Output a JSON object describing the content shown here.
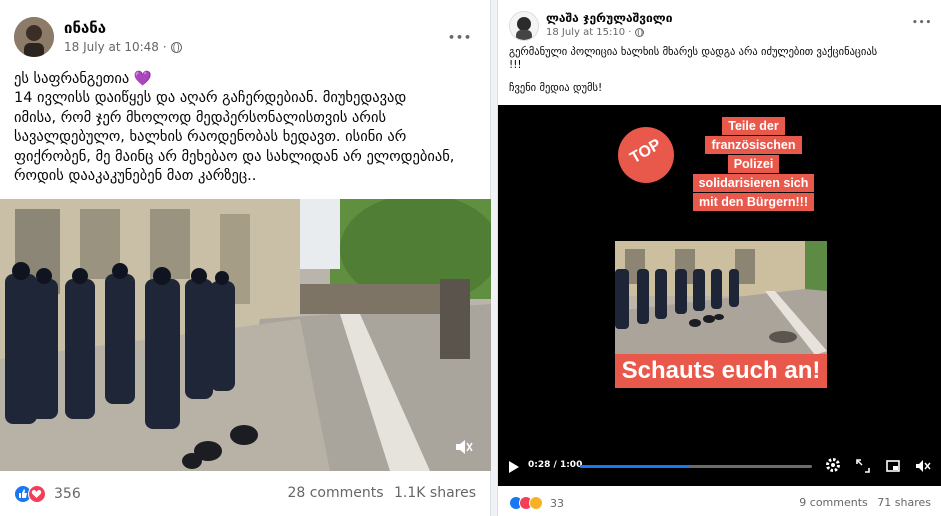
{
  "left_post": {
    "author": "ინანა",
    "date": "18 July at 10:48 ·",
    "more": "•••",
    "caption_lines": [
      "ეს საფრანგეთია 💜",
      "14 ივლისს დაიწყეს და აღარ გაჩერდებიან. მიუხედავად",
      "იმისა, რომ ჯერ მხოლოდ მედპერსონალისთვის არის",
      "სავალდებულო, ხალხის რაოდენობას ხედავთ. ისინი არ",
      "ფიქრობენ, მე მაინც არ მეხებაო და სახლიდან არ ელოდებიან,",
      "როდის დააკაკუნებენ მათ კარზეც.."
    ],
    "reaction_count": "356",
    "comments": "28 comments",
    "shares": "1.1K shares"
  },
  "right_post": {
    "author": "ლაშა ჯერულაშვილი",
    "date": "18 July at 15:10 ·",
    "more": "•••",
    "caption_lines": [
      "გერმანული პოლიცია ხალხის მხარეს დადგა არა იძულებით ვაქცინაციას",
      "!!!",
      "ჩვენი მედია დუმს!"
    ],
    "video": {
      "badge": "TOP",
      "title_lines": [
        "Teile der",
        "französischen",
        "Polizei",
        "solidarisieren sich",
        "mit den Bürgern!!!"
      ],
      "subtitle": "Schauts euch an!",
      "time": "0:28 / 1:00",
      "progress": 0.47
    },
    "reaction_count": "33",
    "comments": "9 comments",
    "shares": "71 shares"
  },
  "colors": {
    "brand_blue": "#1877f2",
    "love_red": "#f33e58",
    "overlay_red": "#e8584b"
  }
}
